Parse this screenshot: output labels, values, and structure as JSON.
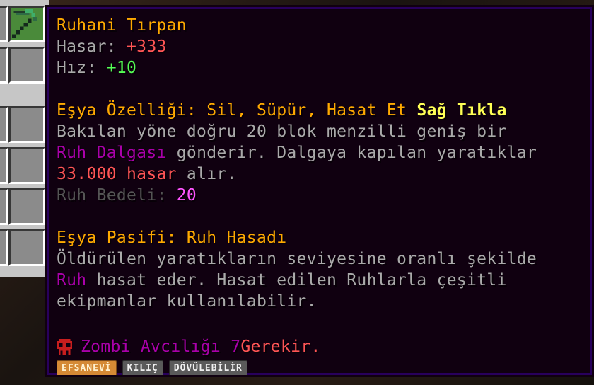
{
  "item": {
    "name": "Ruhani Tırpan",
    "stats": [
      {
        "label": "Hasar: ",
        "value": "+333",
        "color": "#ff5555"
      },
      {
        "label": "Hız: ",
        "value": "+10",
        "color": "#55ff55"
      }
    ]
  },
  "ability": {
    "title": "Eşya Özelliği: Sil, Süpür, Hasat Et",
    "trigger": "Sağ Tıkla",
    "line1": "Bakılan yöne doğru 20 blok menzilli geniş bir",
    "line2_highlight": "Ruh Dalgası",
    "line2_rest": " gönderir. Dalgaya kapılan yaratıklar",
    "line3_damage": "33.000 hasar",
    "line3_rest": " alır.",
    "cost_label": "Ruh Bedeli: ",
    "cost_value": "20"
  },
  "passive": {
    "title": "Eşya Pasifi: Ruh Hasadı",
    "line1": "Öldürülen yaratıkların seviyesine oranlı şekilde",
    "line2_highlight": "Ruh",
    "line2_rest": " hasat eder. Hasat edilen Ruhlarla çeşitli",
    "line3": "ekipmanlar kullanılabilir."
  },
  "requirement": {
    "skill": "Zombi Avcılığı 7",
    "suffix": " Gerekir."
  },
  "tags": {
    "rarity": "EFSANEVİ",
    "type": "KILIÇ",
    "upgrade": "DÖVÜLEBİLİR"
  },
  "icons": {
    "item": "scythe-icon",
    "requirement": "skull-icon"
  },
  "colors": {
    "tooltip_bg": "#100010",
    "tooltip_border": "#28005c",
    "gold": "#ffaa00",
    "gray": "#aaaaaa",
    "purple": "#aa00aa",
    "pink": "#ff55ff",
    "red": "#ff5555",
    "green": "#55ff55",
    "yellow": "#ffff55"
  }
}
